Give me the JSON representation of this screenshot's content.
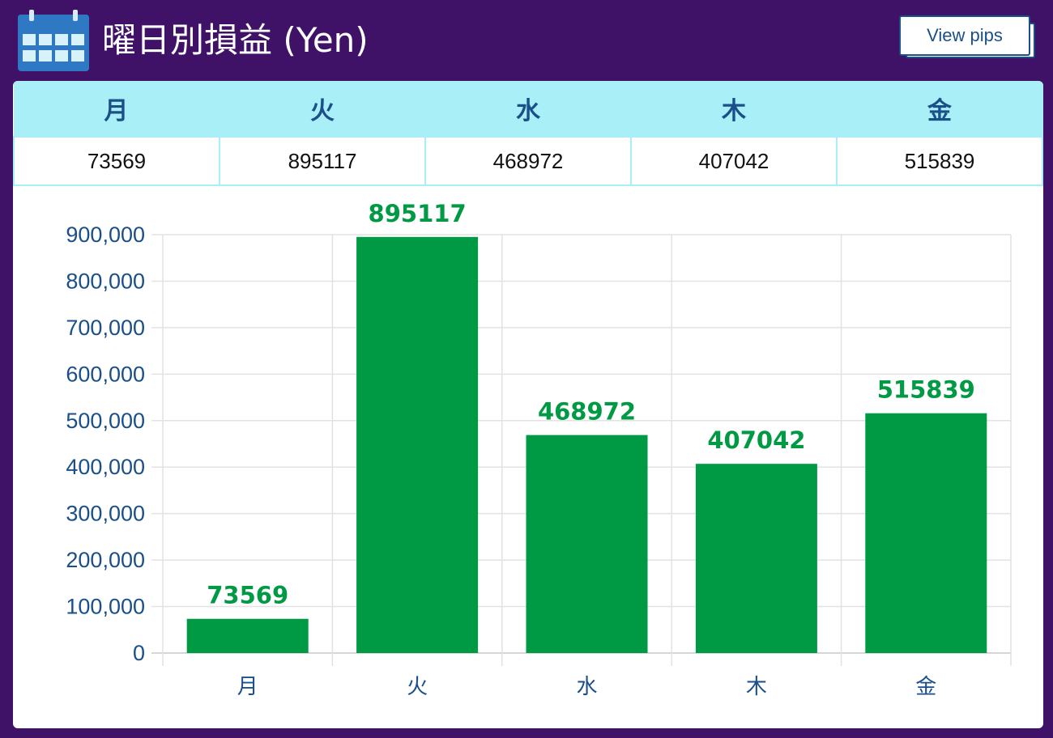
{
  "header": {
    "title": "曜日別損益 (Yen)",
    "icon": "calendar-icon",
    "button_label": "View pips"
  },
  "colors": {
    "background": "#3f1268",
    "bar": "#009944",
    "table_header": "#a8eff8",
    "text_accent": "#1a4f8a"
  },
  "table": {
    "headers": [
      "月",
      "火",
      "水",
      "木",
      "金"
    ],
    "values": [
      "73569",
      "895117",
      "468972",
      "407042",
      "515839"
    ]
  },
  "chart_data": {
    "type": "bar",
    "categories": [
      "月",
      "火",
      "水",
      "木",
      "金"
    ],
    "values": [
      73569,
      895117,
      468972,
      407042,
      515839
    ],
    "data_labels": [
      "73569",
      "895117",
      "468972",
      "407042",
      "515839"
    ],
    "ylim": [
      0,
      900000
    ],
    "yticks": [
      0,
      100000,
      200000,
      300000,
      400000,
      500000,
      600000,
      700000,
      800000,
      900000
    ],
    "ytick_labels": [
      "0",
      "100,000",
      "200,000",
      "300,000",
      "400,000",
      "500,000",
      "600,000",
      "700,000",
      "800,000",
      "900,000"
    ],
    "grid": true,
    "legend": "none",
    "title": "",
    "xlabel": "",
    "ylabel": ""
  }
}
